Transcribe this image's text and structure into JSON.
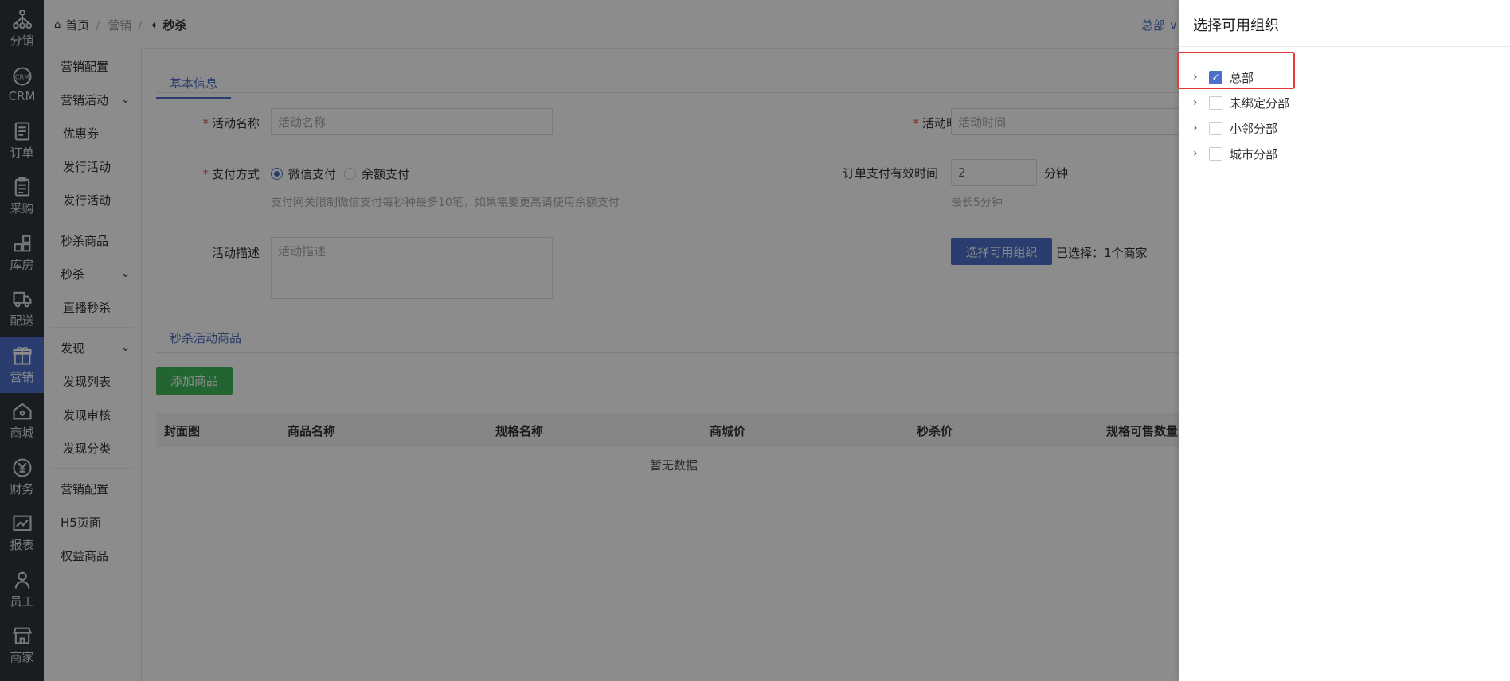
{
  "rail": [
    {
      "label": "分销",
      "icon": "share-tree-icon"
    },
    {
      "label": "CRM",
      "icon": "crm-icon"
    },
    {
      "label": "订单",
      "icon": "order-doc-icon"
    },
    {
      "label": "采购",
      "icon": "clipboard-icon"
    },
    {
      "label": "库房",
      "icon": "warehouse-grid-icon"
    },
    {
      "label": "配送",
      "icon": "truck-icon"
    },
    {
      "label": "营销",
      "icon": "gift-icon",
      "active": true
    },
    {
      "label": "商城",
      "icon": "home-icon"
    },
    {
      "label": "财务",
      "icon": "yen-icon"
    },
    {
      "label": "报表",
      "icon": "chart-icon"
    },
    {
      "label": "员工",
      "icon": "user-icon"
    },
    {
      "label": "商家",
      "icon": "store-icon"
    }
  ],
  "subnav": [
    {
      "label": "营销配置"
    },
    {
      "label": "营销活动",
      "chevron": true
    },
    {
      "label": "优惠券",
      "child": true
    },
    {
      "label": "发行活动",
      "child": true
    },
    {
      "label": "发行活动",
      "child": true
    },
    {
      "label": "秒杀商品"
    },
    {
      "label": "秒杀",
      "chevron": true
    },
    {
      "label": "直播秒杀",
      "child": true
    },
    {
      "label": "发现",
      "chevron": true
    },
    {
      "label": "发现列表",
      "child": true
    },
    {
      "label": "发现审核",
      "child": true
    },
    {
      "label": "发现分类",
      "child": true
    },
    {
      "label": "营销配置"
    },
    {
      "label": "H5页面"
    },
    {
      "label": "权益商品"
    }
  ],
  "breadcrumb": {
    "home": "首页",
    "level1": "营销",
    "current": "秒杀"
  },
  "org_switch": "总部 ∨",
  "tabs": {
    "basic": "基本信息",
    "goods": "秒杀活动商品"
  },
  "form": {
    "activity_name_label": "活动名称",
    "activity_name_placeholder": "活动名称",
    "activity_time_label": "活动时间",
    "activity_time_placeholder": "活动时间",
    "pay_method_label": "支付方式",
    "pay_wechat": "微信支付",
    "pay_balance": "余额支付",
    "pay_hint": "支付网关限制微信支付每秒种最多10笔，如果需要更高请使用余额支付",
    "order_valid_label": "订单支付有效时间",
    "order_valid_value": "2",
    "order_valid_unit": "分钟",
    "order_valid_hint": "最长5分钟",
    "desc_label": "活动描述",
    "desc_placeholder": "活动描述",
    "choose_org_button": "选择可用组织",
    "chosen_text": "已选择：1个商家",
    "required_mark": "*"
  },
  "add_goods_button": "添加商品",
  "table": {
    "columns": [
      "封面图",
      "商品名称",
      "规格名称",
      "商城价",
      "秒杀价",
      "规格可售数量"
    ],
    "empty": "暂无数据"
  },
  "drawer": {
    "title": "选择可用组织",
    "items": [
      {
        "label": "总部",
        "checked": true
      },
      {
        "label": "未绑定分部",
        "checked": false
      },
      {
        "label": "小邻分部",
        "checked": false
      },
      {
        "label": "城市分部",
        "checked": false
      }
    ]
  },
  "colors": {
    "primary": "#4e6fc9",
    "green": "#3fb85a",
    "rail_bg": "#2e353f",
    "highlight": "#e53935"
  }
}
